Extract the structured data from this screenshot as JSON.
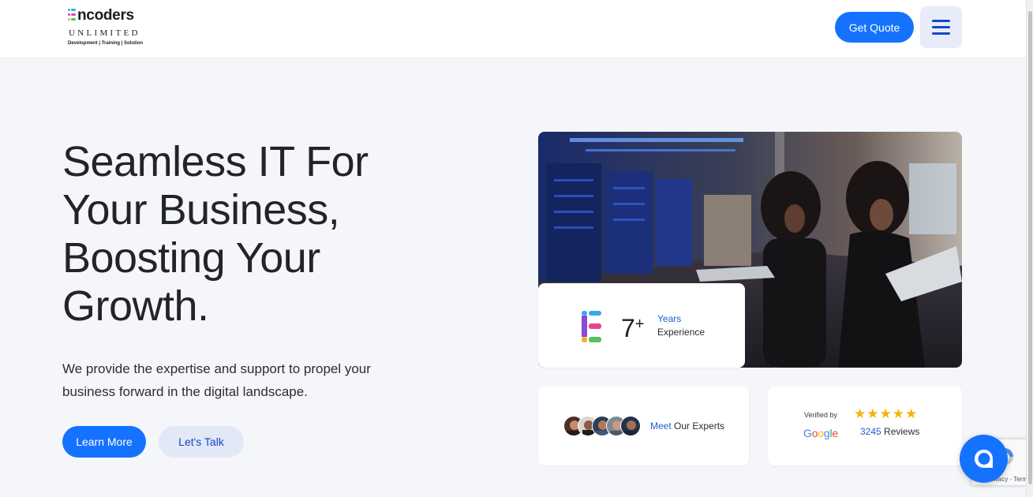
{
  "brand": {
    "name_first_letter": "E",
    "name_rest": "ncoders",
    "sub": "UNLIMITED",
    "tagline": "Development | Training | Solution",
    "colors": {
      "blue": "#1572ff",
      "dark_blue": "#1447c4",
      "text_link": "#1f5fd1"
    }
  },
  "header": {
    "get_quote_label": "Get Quote",
    "menu_icon": "hamburger-menu-icon"
  },
  "hero": {
    "title": "Seamless IT For Your Business, Boosting Your Growth.",
    "description": "We provide the expertise and support to propel your business forward in the digital landscape.",
    "learn_more_label": "Learn More",
    "lets_talk_label": "Let's Talk"
  },
  "experience_card": {
    "number": "7",
    "plus": "+",
    "years_label": "Years",
    "experience_label": "Experience"
  },
  "experts_card": {
    "meet_label": "Meet",
    "experts_label": "Our Experts"
  },
  "google_card": {
    "verified_label": "Verified by",
    "google_label": "Google",
    "stars": "★★★★★",
    "review_count": "3245",
    "reviews_label": "Reviews"
  },
  "recaptcha": {
    "terms_text": "Privacy - Terms"
  },
  "chat": {
    "icon": "chat-bubble-icon"
  }
}
